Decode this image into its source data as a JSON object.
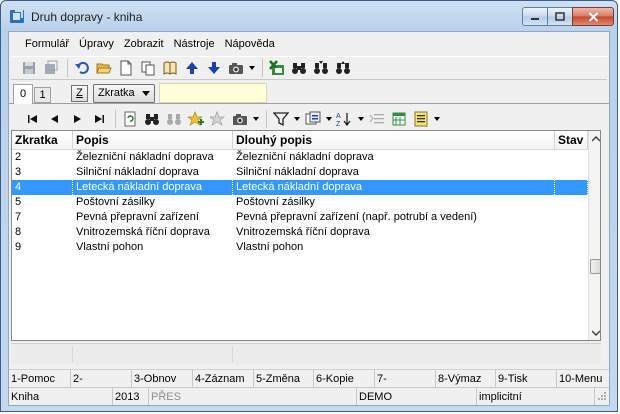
{
  "window": {
    "title": "Druh dopravy - kniha"
  },
  "menu": [
    "Formulář",
    "Úpravy",
    "Zobrazit",
    "Nástroje",
    "Nápověda"
  ],
  "tabs": {
    "tab0": "0",
    "tab1": "1",
    "z_button": "Z",
    "combo_value": "Zkratka"
  },
  "grid": {
    "headers": [
      "Zkratka",
      "Popis",
      "Dlouhý popis",
      "Stav"
    ],
    "rows": [
      [
        "2",
        "Železniční nákladní doprava",
        "Železniční nákladní doprava",
        ""
      ],
      [
        "3",
        "Silniční nákladní doprava",
        "Silniční nákladní doprava",
        ""
      ],
      [
        "4",
        "Letecká nákladní doprava",
        "Letecká nákladní doprava",
        ""
      ],
      [
        "5",
        "Poštovní zásilky",
        "Poštovní zásilky",
        ""
      ],
      [
        "7",
        "Pevná přepravní zařízení",
        "Pevná přepravní zařízení (např. potrubí a vedení)",
        ""
      ],
      [
        "8",
        "Vnitrozemská říční doprava",
        "Vnitrozemská říční doprava",
        ""
      ],
      [
        "9",
        "Vlastní pohon",
        "Vlastní pohon",
        ""
      ]
    ],
    "selected_row": 2
  },
  "fkeys": [
    "1-Pomoc",
    "2-",
    "3-Obnov",
    "4-Záznam",
    "5-Změna",
    "6-Kopie",
    "7-",
    "8-Výmaz",
    "9-Tisk",
    "10-Menu"
  ],
  "status": {
    "module": "Kniha",
    "year": "2013",
    "mode": "PŘES",
    "database": "DEMO",
    "setting": "implicitní"
  },
  "colors": {
    "selection": "#3399ff",
    "filter_field": "#ffffd8",
    "close_button": "#c7432f"
  }
}
